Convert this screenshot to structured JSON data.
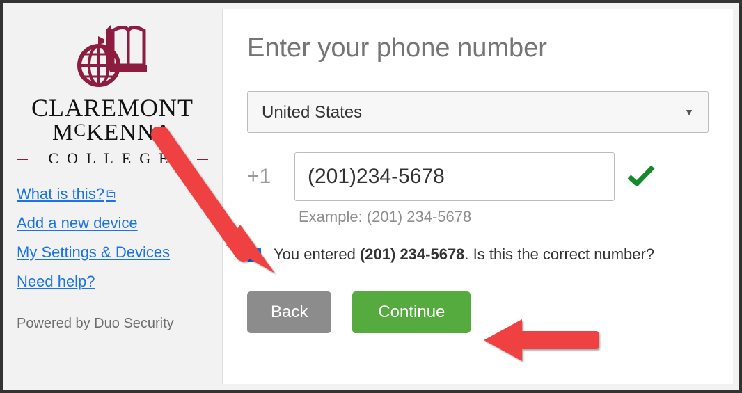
{
  "brand": {
    "line1": "CLAREMONT",
    "line2": "M",
    "line2b": "KENNA",
    "line3": "COLLEGE"
  },
  "sidebar": {
    "links": {
      "what": "What is this?",
      "add": "Add a new device",
      "settings": "My Settings & Devices",
      "help": "Need help?"
    },
    "powered": "Powered by Duo Security"
  },
  "main": {
    "heading": "Enter your phone number",
    "country": "United States",
    "cc": "+1",
    "phone": "(201)234-5678",
    "example": "Example: (201) 234-5678",
    "confirm_prefix": "You entered ",
    "confirm_number": "(201) 234-5678",
    "confirm_suffix": ". Is this the correct number?",
    "back": "Back",
    "continue": "Continue"
  }
}
